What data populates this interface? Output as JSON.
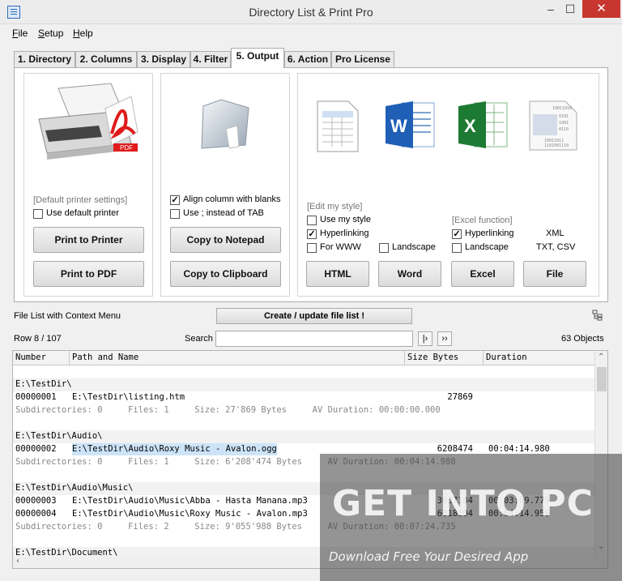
{
  "window": {
    "title": "Directory List & Print Pro",
    "min": "–",
    "max": "☐",
    "close": "✕"
  },
  "menu": [
    {
      "key": "F",
      "rest": "ile"
    },
    {
      "key": "S",
      "rest": "etup"
    },
    {
      "key": "H",
      "rest": "elp"
    }
  ],
  "tabs": [
    "1. Directory",
    "2. Columns",
    "3. Display",
    "4. Filter",
    "5. Output",
    "6. Action",
    "Pro License"
  ],
  "printer": {
    "settings": "[Default printer settings]",
    "use_default": "Use default printer",
    "print_printer": "Print to Printer",
    "print_pdf": "Print to PDF",
    "pdf_badge": "PDF"
  },
  "copy": {
    "align": "Align column with blanks",
    "use_semicolon": "Use  ;  instead of TAB",
    "notepad": "Copy to Notepad",
    "clipboard": "Copy to Clipboard"
  },
  "export": {
    "edit_style": "[Edit my style]",
    "use_style": "Use my style",
    "hyperlinking": "Hyperlinking",
    "for_www": "For WWW",
    "landscape": "Landscape",
    "excel_function": "[Excel function]",
    "excel_hyper": "Hyperlinking",
    "excel_landscape": "Landscape",
    "xml": "XML",
    "txt_csv": "TXT, CSV",
    "html": "HTML",
    "word": "Word",
    "excel": "Excel",
    "file": "File"
  },
  "list_header": {
    "context": "File List with Context Menu",
    "create": "Create / update file list !",
    "row": "Row 8 / 107",
    "search": "Search",
    "search_value": "",
    "next": "|›",
    "next_all": "››",
    "objects": "63 Objects"
  },
  "columns": [
    "Number",
    "Path and Name",
    "Size Bytes",
    "Duration"
  ],
  "rows": [
    {
      "type": "blank"
    },
    {
      "type": "dir",
      "text": "E:\\TestDir\\"
    },
    {
      "type": "file",
      "num": "00000001",
      "path": "E:\\TestDir\\listing.htm",
      "size": "27869",
      "dur": ""
    },
    {
      "type": "sub",
      "text": "Subdirectories: 0     Files: 1     Size: 27'869 Bytes     AV Duration: 00:00:00.000"
    },
    {
      "type": "blank"
    },
    {
      "type": "dir",
      "text": "E:\\TestDir\\Audio\\"
    },
    {
      "type": "file",
      "num": "00000002",
      "path": "E:\\TestDir\\Audio\\Roxy Music - Avalon.ogg",
      "size": "6208474",
      "dur": "00:04:14.980",
      "selected": true
    },
    {
      "type": "sub",
      "text": "Subdirectories: 0     Files: 1     Size: 6'208'474 Bytes     AV Duration: 00:04:14.980"
    },
    {
      "type": "blank"
    },
    {
      "type": "dir",
      "text": "E:\\TestDir\\Audio\\Music\\"
    },
    {
      "type": "file",
      "num": "00000003",
      "path": "E:\\TestDir\\Audio\\Music\\Abba - Hasta Manana.mp3",
      "size": "3037184",
      "dur": "00:03:09.779"
    },
    {
      "type": "file",
      "num": "00000004",
      "path": "E:\\TestDir\\Audio\\Music\\Roxy Music - Avalon.mp3",
      "size": "6018804",
      "dur": "00:04:14.956"
    },
    {
      "type": "sub",
      "text": "Subdirectories: 0     Files: 2     Size: 9'055'988 Bytes     AV Duration: 00:07:24.735"
    },
    {
      "type": "blank"
    },
    {
      "type": "dir",
      "text": "E:\\TestDir\\Document\\"
    }
  ],
  "watermark": {
    "big": "GET INTO PC",
    "small": "Download Free Your Desired App"
  }
}
